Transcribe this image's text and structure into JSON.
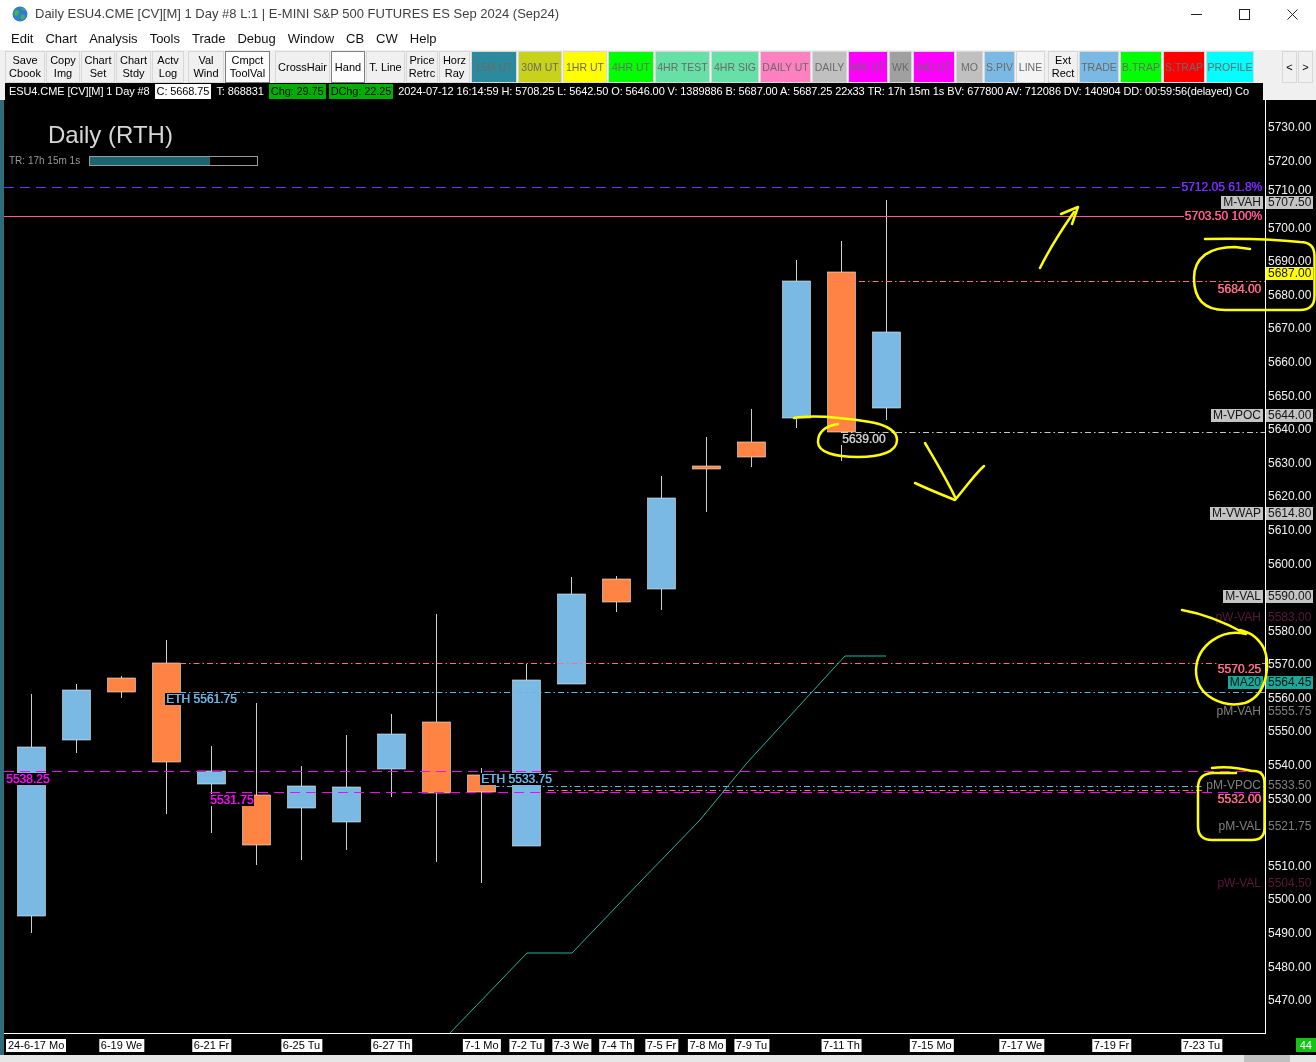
{
  "window": {
    "title": "Daily ESU4.CME [CV][M] 1 Day #8 L:1 | E-MINI S&P 500 FUTURES ES Sep 2024 (Sep24)"
  },
  "menu": [
    "Edit",
    "Chart",
    "Analysis",
    "Tools",
    "Trade",
    "Debug",
    "Window",
    "CB",
    "CW",
    "Help"
  ],
  "toolbar": [
    {
      "label": "Save\nCbook",
      "kind": "plain",
      "pressed": false
    },
    {
      "label": "Copy\nImg",
      "kind": "plain",
      "pressed": false
    },
    {
      "label": "Chart\nSet",
      "kind": "plain",
      "pressed": false
    },
    {
      "label": "Chart\nStdy",
      "kind": "plain",
      "pressed": false
    },
    {
      "label": "Actv\nLog",
      "kind": "plain",
      "pressed": false
    },
    {
      "label": "Val\nWind",
      "kind": "plain",
      "pressed": false
    },
    {
      "label": "Cmpct\nToolVal",
      "kind": "plain",
      "pressed": true
    },
    {
      "label": "CrossHair",
      "kind": "plain",
      "pressed": false
    },
    {
      "label": "Hand",
      "kind": "plain",
      "pressed": true
    },
    {
      "label": "T. Line",
      "kind": "plain",
      "pressed": false
    },
    {
      "label": "Price\nRetrc",
      "kind": "plain",
      "pressed": false
    },
    {
      "label": "Horz\nRay",
      "kind": "plain",
      "pressed": false
    },
    {
      "label": "15M UT",
      "kind": "color",
      "color": "#2b8a9e",
      "pressed": false
    },
    {
      "label": "30M UT",
      "kind": "color",
      "color": "#c8d21a",
      "pressed": false
    },
    {
      "label": "1HR UT",
      "kind": "color",
      "color": "#ffff00",
      "pressed": false
    },
    {
      "label": "4HR UT",
      "kind": "color",
      "color": "#00ff00",
      "pressed": false
    },
    {
      "label": "4HR TEST",
      "kind": "color",
      "color": "#66e0a6",
      "pressed": false
    },
    {
      "label": "4HR SIG",
      "kind": "color",
      "color": "#66e0a6",
      "pressed": false
    },
    {
      "label": "DAILY UT",
      "kind": "color",
      "color": "#ff80c0",
      "pressed": false
    },
    {
      "label": "DAILY",
      "kind": "color",
      "color": "#c0c0c0",
      "pressed": false
    },
    {
      "label": "WK UT",
      "kind": "color",
      "color": "#ff00ff",
      "pressed": false
    },
    {
      "label": "WK",
      "kind": "color",
      "color": "#a0a0a0",
      "pressed": false
    },
    {
      "label": "MO UT",
      "kind": "color",
      "color": "#ff00ff",
      "pressed": false
    },
    {
      "label": "MO",
      "kind": "color",
      "color": "#c0c0c0",
      "pressed": false
    },
    {
      "label": "S.PIV",
      "kind": "color",
      "color": "#7ab9e3",
      "pressed": false
    },
    {
      "label": "LINE",
      "kind": "color",
      "color": "#f4f4f4",
      "pressed": false
    },
    {
      "label": "Ext\nRect",
      "kind": "plain",
      "pressed": false
    },
    {
      "label": "TRADE",
      "kind": "color",
      "color": "#7ab9e3",
      "pressed": false
    },
    {
      "label": "B.TRAP",
      "kind": "color",
      "color": "#00ff00",
      "pressed": false
    },
    {
      "label": "S.TRAP",
      "kind": "color",
      "color": "#ff0000",
      "pressed": false
    },
    {
      "label": "PROFILE",
      "kind": "color",
      "color": "#00ffff",
      "pressed": false
    }
  ],
  "toolbar_scroll": [
    "<",
    ">"
  ],
  "quote_bar": [
    {
      "text": "ESU4.CME [CV][M] 1 Day #8",
      "kind": "plain"
    },
    {
      "text": "C: 5668.75",
      "kind": "inverse"
    },
    {
      "text": "T: 868831",
      "kind": "plain"
    },
    {
      "text": "Chg: 29.75",
      "kind": "up"
    },
    {
      "text": "DChg: 22.25",
      "kind": "up"
    },
    {
      "text": "2024-07-12 16:14:59 H: 5708.25 L: 5642.50 O: 5646.00 V: 1389886 B: 5687.00 A: 5687.25 22x33 TR: 17h 15m 1s BV: 677800 AV: 712086 DV: 140904 DD: 00:59:56(delayed) Co",
      "kind": "plain"
    }
  ],
  "chart": {
    "title": "Daily (RTH)",
    "timer": {
      "label": "TR: 17h 15m 1s",
      "level": 0.72
    },
    "level_lines": [
      {
        "text": "5712.05 61.8%",
        "kind": "dashed",
        "color": "#7a2cff"
      },
      {
        "text": "5703.50 100%",
        "kind": "solid",
        "color": "#ff5a96"
      },
      {
        "text": "5684.00",
        "kind": "dashdot",
        "color": "#ff6b8b"
      },
      {
        "text": "5639.00",
        "kind": "dashdot",
        "color": "#c8c8c8"
      },
      {
        "text": "5570.25",
        "kind": "dashdot",
        "color": "#ff6b8b"
      },
      {
        "text": "ETH 5561.75",
        "kind": "dashdot",
        "color": "#6ab4e6"
      },
      {
        "text": "5538.25",
        "kind": "dashed",
        "color": "#ff00ff"
      },
      {
        "text": "ETH 5533.75",
        "kind": "dashdot",
        "color": "#6ab4e6"
      },
      {
        "text": "5531.75",
        "kind": "dashed",
        "color": "#ff00ff"
      },
      {
        "text": "5532.00",
        "kind": "dashdot",
        "color": "#ff6b8b"
      }
    ],
    "axis_tags": [
      {
        "name": "M-VAH",
        "value": "5707.50",
        "kind": "boxed",
        "color": "#c4c4c4"
      },
      {
        "value": "5687.00",
        "kind": "boxed",
        "color": "#ffff00"
      },
      {
        "name": "M-VPOC",
        "value": "5644.00",
        "kind": "boxed",
        "color": "#c4c4c4"
      },
      {
        "name": "M-VWAP",
        "value": "5614.80",
        "kind": "boxed",
        "color": "#c4c4c4"
      },
      {
        "name": "M-VAL",
        "value": "5590.00",
        "kind": "boxed",
        "color": "#c4c4c4"
      },
      {
        "name": "pW-VAH",
        "value": "5583.00",
        "kind": "plain",
        "color": "#5a1838"
      },
      {
        "name": "MA20",
        "value": "5564.45",
        "kind": "boxed",
        "color": "#1aa898"
      },
      {
        "name": "pM-VAH",
        "value": "5555.75",
        "kind": "plain",
        "color": "#808080"
      },
      {
        "name": "pM-VPOC",
        "value": "5533.50",
        "kind": "plain",
        "color": "#808080"
      },
      {
        "name": "pM-VAL",
        "value": "5521.75",
        "kind": "plain",
        "color": "#808080"
      },
      {
        "name": "pW-VAL",
        "value": "5504.50",
        "kind": "plain",
        "color": "#5a1838"
      }
    ],
    "price_axis": [
      "5730.00",
      "5720.00",
      "5710.00",
      "5700.00",
      "5690.00",
      "5680.00",
      "5670.00",
      "5660.00",
      "5650.00",
      "5640.00",
      "5630.00",
      "5620.00",
      "5610.00",
      "5600.00",
      "5580.00",
      "5570.00",
      "5560.00",
      "5550.00",
      "5540.00",
      "5530.00",
      "5510.00",
      "5500.00",
      "5490.00",
      "5480.00",
      "5470.00"
    ],
    "date_axis": [
      "24-6-17 Mo",
      "6-19 We",
      "6-21 Fr",
      "6-25 Tu",
      "6-27 Th",
      "7-1 Mo",
      "7-2 Tu",
      "7-3 We",
      "7-4 Th",
      "7-5 Fr",
      "7-8 Mo",
      "7-9 Tu",
      "7-11 Th",
      "7-15 Mo",
      "7-17 We",
      "7-19 Fr",
      "7-23 Tu"
    ]
  },
  "status_badge": "44"
}
